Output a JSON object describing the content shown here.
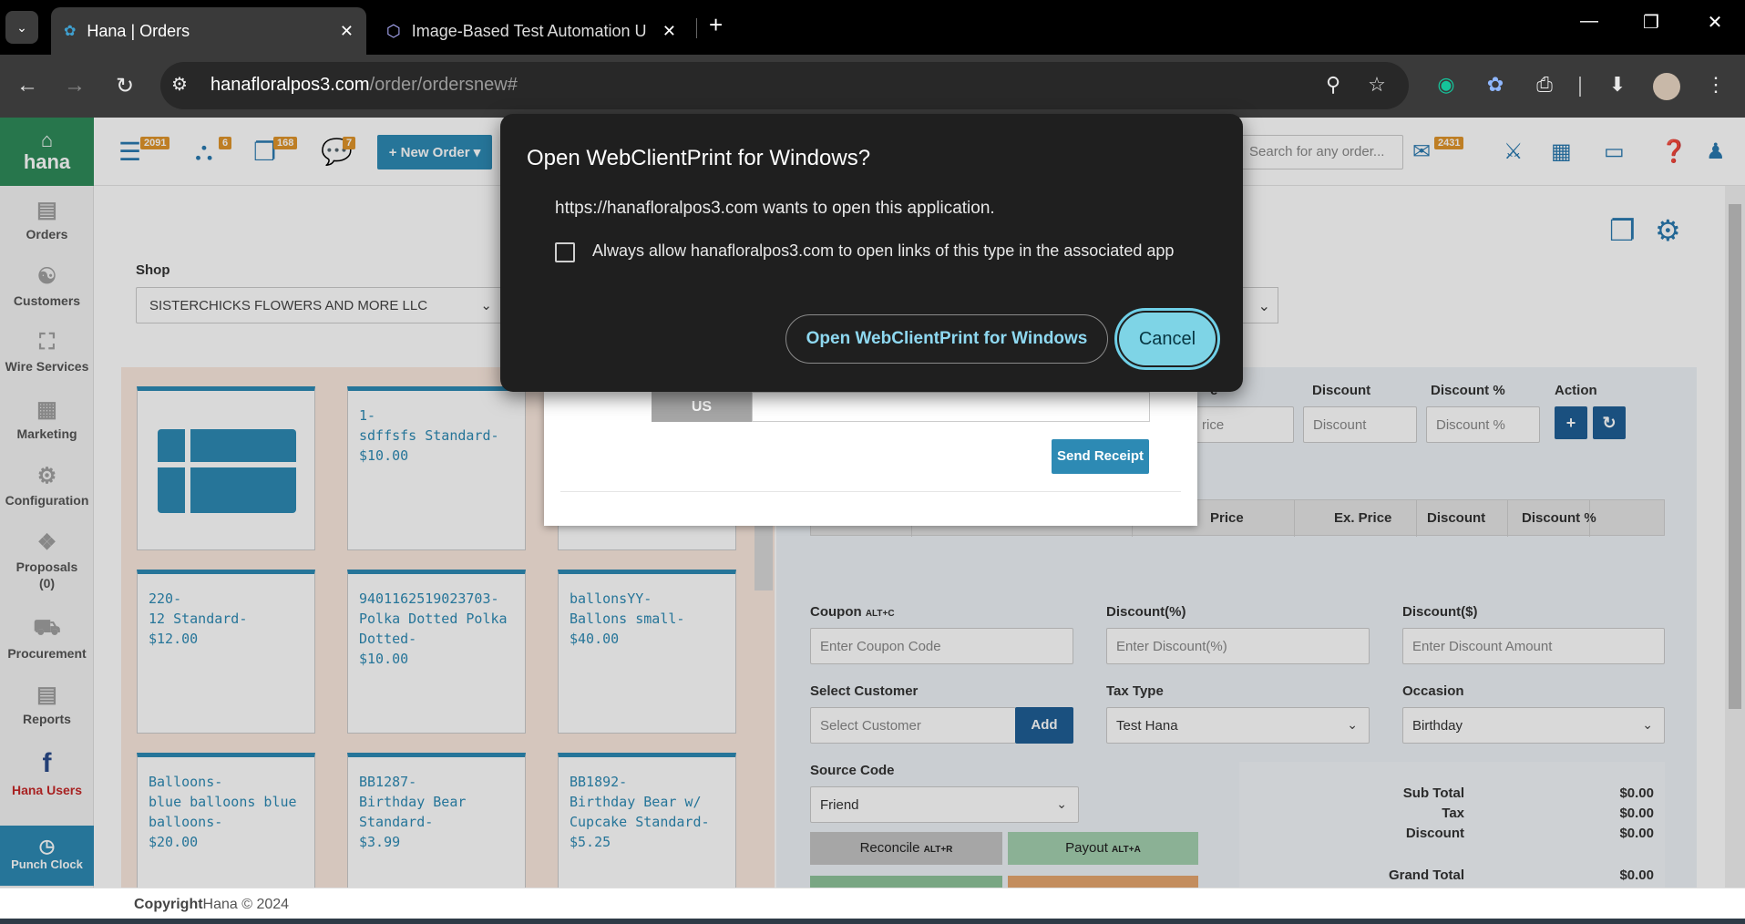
{
  "browser": {
    "tabs": [
      {
        "title": "Hana | Orders",
        "active": true
      },
      {
        "title": "Image-Based Test Automation U",
        "active": false
      }
    ],
    "url_host": "hanafloralpos3.com",
    "url_path": "/order/ordersnew#"
  },
  "sidebar": {
    "brand": "hana",
    "items": [
      {
        "label": "Orders",
        "icon": "orders-icon"
      },
      {
        "label": "Customers",
        "icon": "customers-icon"
      },
      {
        "label": "Wire Services",
        "icon": "wire-services-icon"
      },
      {
        "label": "Marketing",
        "icon": "marketing-icon"
      },
      {
        "label": "Configuration",
        "icon": "configuration-icon"
      },
      {
        "label": "Proposals",
        "sub": "(0)",
        "icon": "proposals-icon"
      },
      {
        "label": "Procurement",
        "icon": "procurement-icon"
      },
      {
        "label": "Reports",
        "icon": "reports-icon"
      },
      {
        "label": "Hana Users",
        "icon": "facebook-icon"
      }
    ],
    "punch_clock": "Punch Clock"
  },
  "topbar": {
    "badges": {
      "orders": "2091",
      "basket": "6",
      "docs": "168",
      "chat": "7",
      "mail": "2431"
    },
    "new_order": "+ New Order ▾",
    "search_placeholder": "Search for any order..."
  },
  "main": {
    "shop_label": "Shop",
    "shop_value": "SISTERCHICKS FLOWERS AND MORE LLC",
    "products": [
      {
        "lines": []
      },
      {
        "lines": [
          "1-",
          "sdffsfs Standard-",
          "$10.00"
        ]
      },
      {
        "lines": []
      },
      {
        "lines": [
          "220-",
          "12 Standard-",
          "$12.00"
        ]
      },
      {
        "lines": [
          "9401162519023703-",
          "Polka Dotted Polka",
          "Dotted-",
          "$10.00"
        ]
      },
      {
        "lines": [
          "ballonsYY-",
          "Ballons small-",
          "$40.00"
        ]
      },
      {
        "lines": [
          "Balloons-",
          "blue balloons blue",
          "balloons-",
          "$20.00"
        ]
      },
      {
        "lines": [
          "BB1287-",
          "Birthday Bear",
          "Standard-",
          "$3.99"
        ]
      },
      {
        "lines": [
          "BB1892-",
          "Birthday Bear w/",
          "Cupcake Standard-",
          "$5.25"
        ]
      }
    ],
    "item_fields": {
      "price_placeholder": "rice",
      "discount_label": "Discount",
      "discount_placeholder": "Discount",
      "discount_pct_label": "Discount %",
      "discount_pct_placeholder": "Discount %",
      "action_label": "Action",
      "price_label_partial": "e"
    },
    "grid_headers": [
      "Price",
      "Ex. Price",
      "Discount",
      "Discount %"
    ],
    "coupon_label": "Coupon",
    "coupon_kbd": "ALT+C",
    "coupon_placeholder": "Enter Coupon Code",
    "discount_pct_label": "Discount(%)",
    "discount_pct_placeholder": "Enter Discount(%)",
    "discount_amt_label": "Discount($)",
    "discount_amt_placeholder": "Enter Discount Amount",
    "select_customer_label": "Select Customer",
    "select_customer_placeholder": "Select Customer",
    "add_label": "Add",
    "tax_type_label": "Tax Type",
    "tax_type_value": "Test Hana",
    "occasion_label": "Occasion",
    "occasion_value": "Birthday",
    "source_code_label": "Source Code",
    "source_code_value": "Friend",
    "reconcile_label": "Reconcile",
    "reconcile_kbd": "ALT+R",
    "payout_label": "Payout",
    "payout_kbd": "ALT+A",
    "summary": [
      {
        "label": "Sub Total",
        "value": "$0.00"
      },
      {
        "label": "Tax",
        "value": "$0.00"
      },
      {
        "label": "Discount",
        "value": "$0.00"
      },
      {
        "label": "Grand Total",
        "value": "$0.00"
      }
    ]
  },
  "receipt_modal": {
    "country": "US",
    "send_receipt": "Send Receipt"
  },
  "footer": {
    "copyright_label": "Copyright",
    "copyright_text": "Hana © 2024"
  },
  "dialog": {
    "title": "Open WebClientPrint for Windows?",
    "message": "https://hanafloralpos3.com wants to open this application.",
    "checkbox_label": "Always allow hanafloralpos3.com to open links of this type in the associated app",
    "open_button": "Open WebClientPrint for Windows",
    "cancel_button": "Cancel"
  },
  "colors": {
    "brand_green": "#2e8b5a",
    "primary_blue": "#2d8ab4",
    "dialog_bg": "#1f1f1f",
    "cancel_bg": "#7ed4e6"
  }
}
